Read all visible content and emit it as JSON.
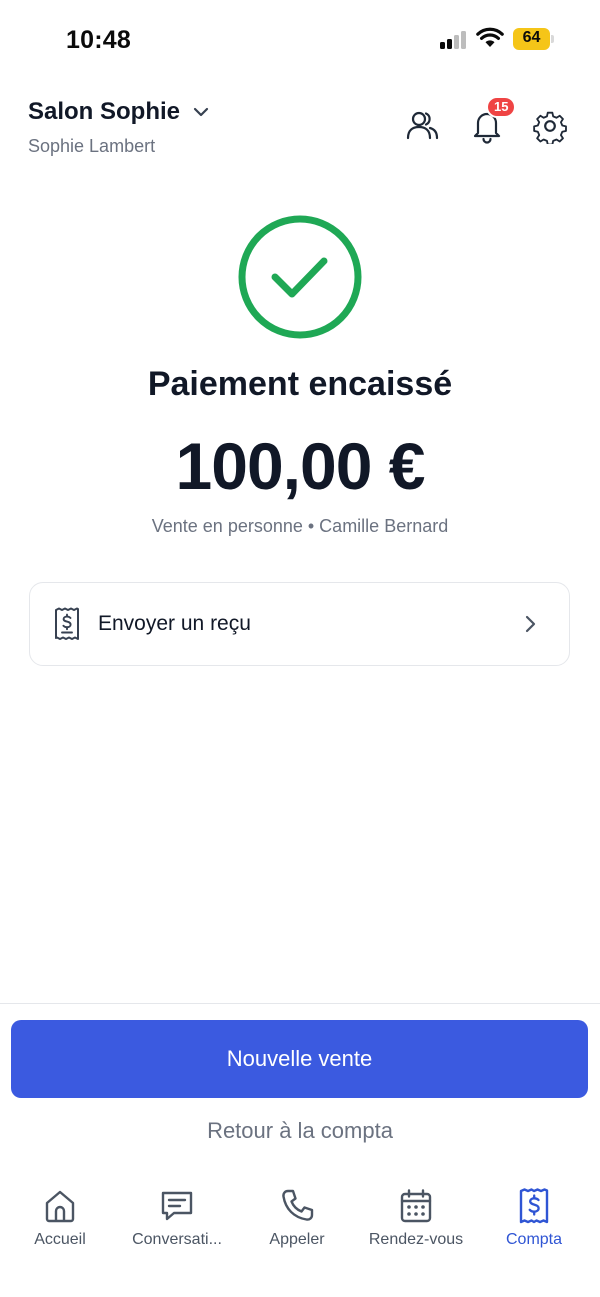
{
  "status_bar": {
    "time": "10:48",
    "battery": "64",
    "battery_color": "#f5c518"
  },
  "header": {
    "salon_name": "Salon Sophie",
    "owner_name": "Sophie Lambert",
    "notification_count": "15",
    "icons": [
      "users-icon",
      "bell-icon",
      "settings-icon",
      "chevron-down-icon"
    ]
  },
  "payment": {
    "status_icon": "check-circle-icon",
    "title": "Paiement encaissé",
    "amount": "100,00 €",
    "meta": "Vente en personne • Camille Bernard"
  },
  "receipt": {
    "label": "Envoyer un reçu",
    "icon": "receipt-icon"
  },
  "actions": {
    "primary_label": "Nouvelle vente",
    "secondary_label": "Retour à la compta"
  },
  "tabs": [
    {
      "label": "Accueil",
      "icon": "home-icon",
      "active": false
    },
    {
      "label": "Conversati...",
      "icon": "chat-icon",
      "active": false
    },
    {
      "label": "Appeler",
      "icon": "phone-icon",
      "active": false
    },
    {
      "label": "Rendez-vous",
      "icon": "calendar-icon",
      "active": false
    },
    {
      "label": "Compta",
      "icon": "dollar-receipt-icon",
      "active": true
    }
  ],
  "colors": {
    "accent": "#3b5ae0",
    "active_tab": "#2f55d4",
    "success": "#1fa855",
    "badge": "#ef4444"
  }
}
